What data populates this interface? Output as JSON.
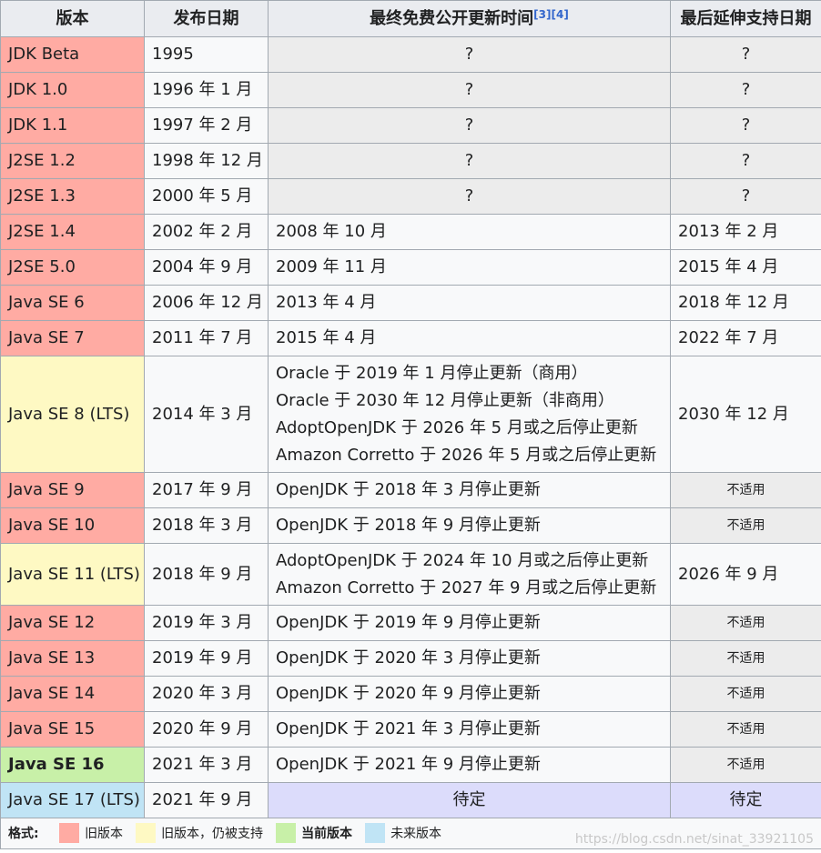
{
  "headers": {
    "version": "版本",
    "release": "发布日期",
    "last_public_update": "最终免费公开更新时间",
    "refs": [
      "[3]",
      "[4]"
    ],
    "extended_support": "最后延伸支持日期"
  },
  "rows": [
    {
      "version": "JDK Beta",
      "status": "old",
      "release": "1995",
      "updates": [
        "?"
      ],
      "updates_style": "unknown",
      "extended": "?",
      "extended_style": "unknown"
    },
    {
      "version": "JDK 1.0",
      "status": "old",
      "release": "1996 年 1 月",
      "updates": [
        "?"
      ],
      "updates_style": "unknown",
      "extended": "?",
      "extended_style": "unknown"
    },
    {
      "version": "JDK 1.1",
      "status": "old",
      "release": "1997 年 2 月",
      "updates": [
        "?"
      ],
      "updates_style": "unknown",
      "extended": "?",
      "extended_style": "unknown"
    },
    {
      "version": "J2SE 1.2",
      "status": "old",
      "release": "1998 年 12 月",
      "updates": [
        "?"
      ],
      "updates_style": "unknown",
      "extended": "?",
      "extended_style": "unknown"
    },
    {
      "version": "J2SE 1.3",
      "status": "old",
      "release": "2000 年 5 月",
      "updates": [
        "?"
      ],
      "updates_style": "unknown",
      "extended": "?",
      "extended_style": "unknown"
    },
    {
      "version": "J2SE 1.4",
      "status": "old",
      "release": "2002 年 2 月",
      "updates": [
        "2008 年 10 月"
      ],
      "updates_style": "normal",
      "extended": "2013 年 2 月",
      "extended_style": "normal"
    },
    {
      "version": "J2SE 5.0",
      "status": "old",
      "release": "2004 年 9 月",
      "updates": [
        "2009 年 11 月"
      ],
      "updates_style": "normal",
      "extended": "2015 年 4 月",
      "extended_style": "normal"
    },
    {
      "version": "Java SE 6",
      "status": "old",
      "release": "2006 年 12 月",
      "updates": [
        "2013 年 4 月"
      ],
      "updates_style": "normal",
      "extended": "2018 年 12 月",
      "extended_style": "normal"
    },
    {
      "version": "Java SE 7",
      "status": "old",
      "release": "2011 年 7 月",
      "updates": [
        "2015 年 4 月"
      ],
      "updates_style": "normal",
      "extended": "2022 年 7 月",
      "extended_style": "normal"
    },
    {
      "version": "Java SE 8 (LTS)",
      "status": "supported",
      "release": "2014 年 3 月",
      "updates": [
        "Oracle 于 2019 年 1 月停止更新（商用）",
        "Oracle 于 2030 年 12 月停止更新（非商用）",
        "AdoptOpenJDK 于 2026 年 5 月或之后停止更新",
        "Amazon Corretto 于 2026 年 5 月或之后停止更新"
      ],
      "updates_style": "normal",
      "extended": "2030 年 12 月",
      "extended_style": "normal"
    },
    {
      "version": "Java SE 9",
      "status": "old",
      "release": "2017 年 9 月",
      "updates": [
        "OpenJDK 于 2018 年 3 月停止更新"
      ],
      "updates_style": "normal",
      "extended": "不适用",
      "extended_style": "na"
    },
    {
      "version": "Java SE 10",
      "status": "old",
      "release": "2018 年 3 月",
      "updates": [
        "OpenJDK 于 2018 年 9 月停止更新"
      ],
      "updates_style": "normal",
      "extended": "不适用",
      "extended_style": "na"
    },
    {
      "version": "Java SE 11 (LTS)",
      "status": "supported",
      "release": "2018 年 9 月",
      "updates": [
        "AdoptOpenJDK 于 2024 年 10 月或之后停止更新",
        "Amazon Corretto 于 2027 年 9 月或之后停止更新"
      ],
      "updates_style": "normal",
      "extended": "2026 年 9 月",
      "extended_style": "normal"
    },
    {
      "version": "Java SE 12",
      "status": "old",
      "release": "2019 年 3 月",
      "updates": [
        "OpenJDK 于 2019 年 9 月停止更新"
      ],
      "updates_style": "normal",
      "extended": "不适用",
      "extended_style": "na"
    },
    {
      "version": "Java SE 13",
      "status": "old",
      "release": "2019 年 9 月",
      "updates": [
        "OpenJDK 于 2020 年 3 月停止更新"
      ],
      "updates_style": "normal",
      "extended": "不适用",
      "extended_style": "na"
    },
    {
      "version": "Java SE 14",
      "status": "old",
      "release": "2020 年 3 月",
      "updates": [
        "OpenJDK 于 2020 年 9 月停止更新"
      ],
      "updates_style": "normal",
      "extended": "不适用",
      "extended_style": "na"
    },
    {
      "version": "Java SE 15",
      "status": "old",
      "release": "2020 年 9 月",
      "updates": [
        "OpenJDK 于 2021 年 3 月停止更新"
      ],
      "updates_style": "normal",
      "extended": "不适用",
      "extended_style": "na"
    },
    {
      "version": "Java SE 16",
      "status": "current",
      "release": "2021 年 3 月",
      "updates": [
        "OpenJDK 于 2021 年 9 月停止更新"
      ],
      "updates_style": "normal",
      "extended": "不适用",
      "extended_style": "na"
    },
    {
      "version": "Java SE 17 (LTS)",
      "status": "future",
      "release": "2021 年 9 月",
      "updates": [
        "待定"
      ],
      "updates_style": "tbd",
      "extended": "待定",
      "extended_style": "tbd"
    }
  ],
  "legend": {
    "title": "格式:",
    "items": [
      {
        "label": "旧版本",
        "color": "#ffaba3",
        "bold": false
      },
      {
        "label": "旧版本，仍被支持",
        "color": "#fef9c3",
        "bold": false
      },
      {
        "label": "当前版本",
        "color": "#c8f0a8",
        "bold": true
      },
      {
        "label": "未来版本",
        "color": "#c0e4f5",
        "bold": false
      }
    ]
  },
  "watermark": "https://blog.csdn.net/sinat_33921105",
  "colors": {
    "old": "#ffaba3",
    "supported": "#fef9c3",
    "current": "#c8f0a8",
    "future": "#c0e4f5",
    "unknown_cell": "#ececec",
    "tbd_cell": "#dcdcfb",
    "header": "#eaecf0",
    "link": "#3366cc"
  }
}
